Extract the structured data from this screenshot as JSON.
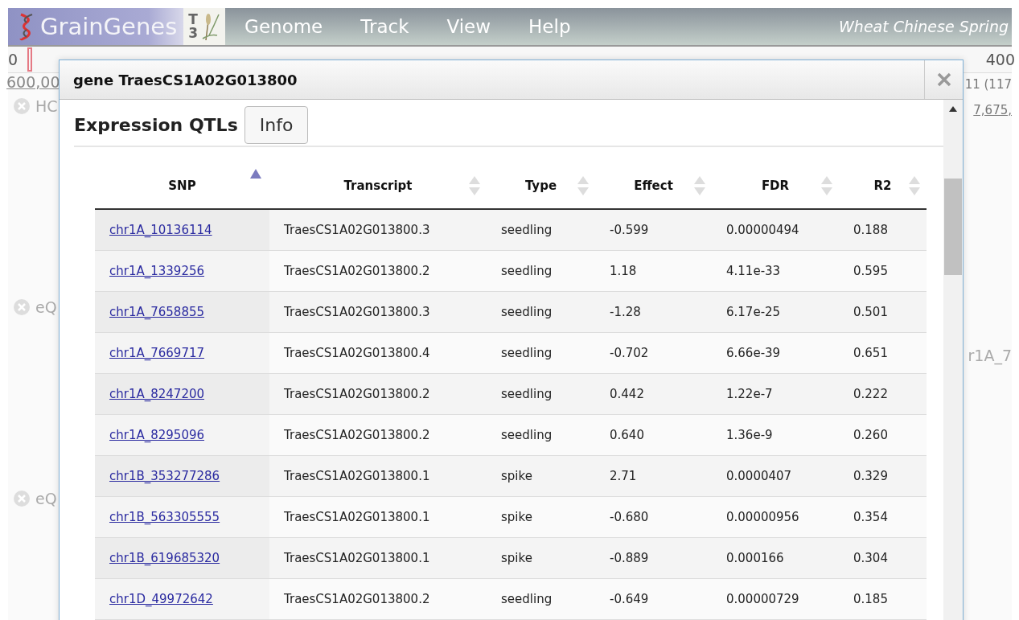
{
  "header": {
    "logo": "GrainGenes",
    "badge": "T",
    "badge_sub": "3",
    "menu": [
      "Genome",
      "Track",
      "View",
      "Help"
    ],
    "assembly": "Wheat Chinese Spring"
  },
  "ruler": {
    "start": "0",
    "end": "400"
  },
  "background": {
    "left_scale": "600,00",
    "right_labels": [
      "11 (117",
      "7,675,"
    ],
    "tracks": [
      {
        "label": "HC"
      },
      {
        "label": "eQ",
        "side": "r1A_7"
      },
      {
        "label": "eQ"
      }
    ]
  },
  "dialog": {
    "title": "gene TraesCS1A02G013800",
    "heading": "Expression QTLs",
    "info_button": "Info",
    "table": {
      "columns": [
        {
          "label": "SNP",
          "sorted": true
        },
        {
          "label": "Transcript",
          "sorted": false
        },
        {
          "label": "Type",
          "sorted": false
        },
        {
          "label": "Effect",
          "sorted": false
        },
        {
          "label": "FDR",
          "sorted": false
        },
        {
          "label": "R2",
          "sorted": false
        }
      ],
      "rows": [
        [
          "chr1A_10136114",
          "TraesCS1A02G013800.3",
          "seedling",
          "-0.599",
          "0.00000494",
          "0.188"
        ],
        [
          "chr1A_1339256",
          "TraesCS1A02G013800.2",
          "seedling",
          "1.18",
          "4.11e-33",
          "0.595"
        ],
        [
          "chr1A_7658855",
          "TraesCS1A02G013800.3",
          "seedling",
          "-1.28",
          "6.17e-25",
          "0.501"
        ],
        [
          "chr1A_7669717",
          "TraesCS1A02G013800.4",
          "seedling",
          "-0.702",
          "6.66e-39",
          "0.651"
        ],
        [
          "chr1A_8247200",
          "TraesCS1A02G013800.2",
          "seedling",
          "0.442",
          "1.22e-7",
          "0.222"
        ],
        [
          "chr1A_8295096",
          "TraesCS1A02G013800.2",
          "seedling",
          "0.640",
          "1.36e-9",
          "0.260"
        ],
        [
          "chr1B_353277286",
          "TraesCS1A02G013800.1",
          "spike",
          "2.71",
          "0.0000407",
          "0.329"
        ],
        [
          "chr1B_563305555",
          "TraesCS1A02G013800.1",
          "spike",
          "-0.680",
          "0.00000956",
          "0.354"
        ],
        [
          "chr1B_619685320",
          "TraesCS1A02G013800.1",
          "spike",
          "-0.889",
          "0.000166",
          "0.304"
        ],
        [
          "chr1D_49972642",
          "TraesCS1A02G013800.2",
          "seedling",
          "-0.649",
          "0.00000729",
          "0.185"
        ]
      ]
    }
  }
}
